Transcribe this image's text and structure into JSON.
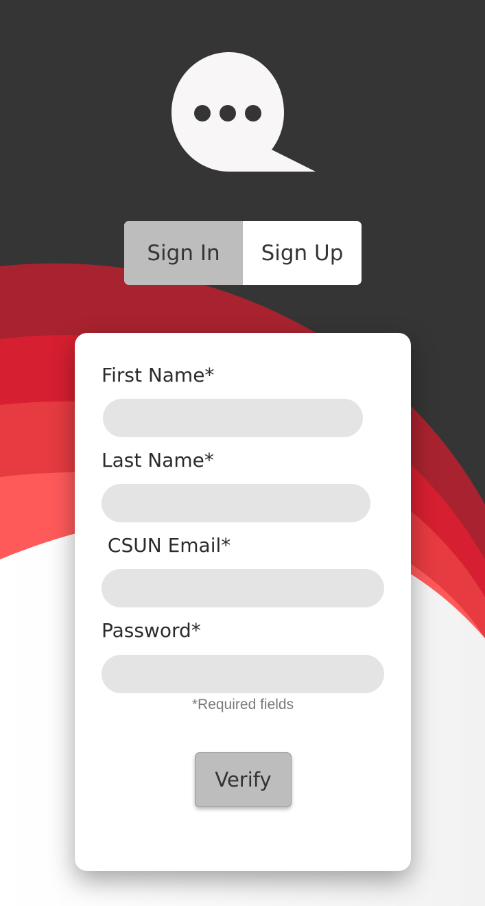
{
  "auth_tabs": {
    "sign_in": "Sign In",
    "sign_up": "Sign Up",
    "active": "sign_in"
  },
  "form": {
    "first_name": {
      "label": "First Name*",
      "value": ""
    },
    "last_name": {
      "label": "Last Name*",
      "value": ""
    },
    "email": {
      "label": " CSUN Email*",
      "value": ""
    },
    "password": {
      "label": "Password*",
      "value": ""
    },
    "required_note": "*Required fields",
    "verify_label": "Verify"
  },
  "icons": {
    "logo": "chat-bubble-ellipsis-icon"
  },
  "colors": {
    "background": "#353535",
    "wave_red_dark": "#a8232f",
    "wave_red": "#d61f30",
    "wave_red_light": "#ff5a5a",
    "card": "#ffffff",
    "input": "#e4e4e4",
    "button": "#bdbdbd"
  }
}
